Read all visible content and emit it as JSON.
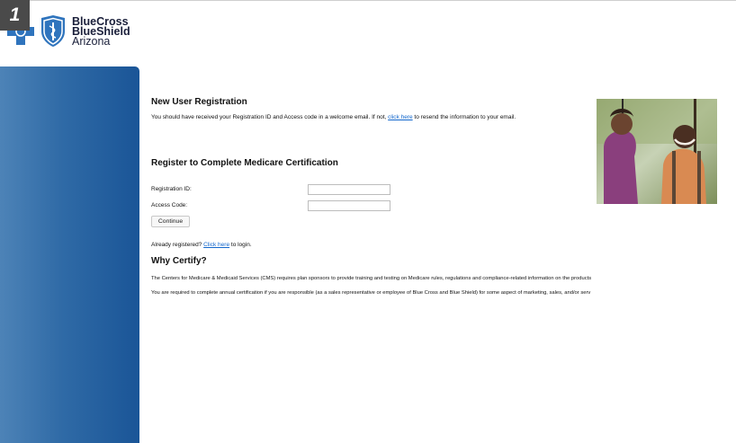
{
  "step_badge": "1",
  "brand": {
    "line1": "BlueCross",
    "line2": "BlueShield",
    "line3": "Arizona",
    "colors": {
      "cross": "#2f74bd",
      "shield": "#2f74bd",
      "text": "#1a1f3a"
    }
  },
  "colors": {
    "sidebar_light": "#4d83b7",
    "sidebar_dark": "#1a5597",
    "link": "#1166cc"
  },
  "registration": {
    "heading": "New User Registration",
    "text_before": "You should have received your Registration ID and Access code in a welcome email. If not, ",
    "link": "click here",
    "text_after": " to resend the information to your email."
  },
  "form": {
    "heading": "Register to Complete Medicare Certification",
    "registration_id_label": "Registration ID:",
    "registration_id_value": "",
    "access_code_label": "Access Code:",
    "access_code_value": "",
    "continue_label": "Continue"
  },
  "login": {
    "text_before": "Already registered? ",
    "link": "Click here",
    "text_after": " to login."
  },
  "why": {
    "heading": "Why Certify?",
    "p1": "The Centers for Medicare & Medicaid Services (CMS) requires plan sponsors to provide training and testing on Medicare rules, regulations and compliance-related information on the products",
    "p2": "You are required to complete annual certification if you are responsible (as a sales representative or employee of Blue Cross and Blue Shield) for some aspect of marketing, sales, and/or serv"
  }
}
